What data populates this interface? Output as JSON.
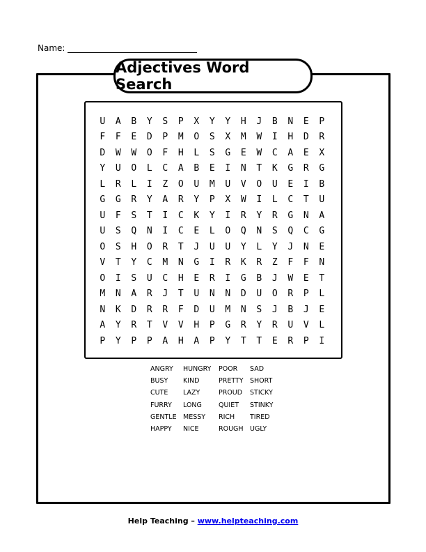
{
  "header": {
    "name_label": "Name:"
  },
  "title": "Adjectives Word Search",
  "grid": [
    [
      "U",
      "A",
      "B",
      "Y",
      "S",
      "P",
      "X",
      "Y",
      "Y",
      "H",
      "J",
      "B",
      "N",
      "E",
      "P"
    ],
    [
      "F",
      "F",
      "E",
      "D",
      "P",
      "M",
      "O",
      "S",
      "X",
      "M",
      "W",
      "I",
      "H",
      "D",
      "R"
    ],
    [
      "D",
      "W",
      "W",
      "O",
      "F",
      "H",
      "L",
      "S",
      "G",
      "E",
      "W",
      "C",
      "A",
      "E",
      "X"
    ],
    [
      "Y",
      "U",
      "O",
      "L",
      "C",
      "A",
      "B",
      "E",
      "I",
      "N",
      "T",
      "K",
      "G",
      "R",
      "G"
    ],
    [
      "L",
      "R",
      "L",
      "I",
      "Z",
      "O",
      "U",
      "M",
      "U",
      "V",
      "O",
      "U",
      "E",
      "I",
      "B"
    ],
    [
      "G",
      "G",
      "R",
      "Y",
      "A",
      "R",
      "Y",
      "P",
      "X",
      "W",
      "I",
      "L",
      "C",
      "T",
      "U"
    ],
    [
      "U",
      "F",
      "S",
      "T",
      "I",
      "C",
      "K",
      "Y",
      "I",
      "R",
      "Y",
      "R",
      "G",
      "N",
      "A"
    ],
    [
      "U",
      "S",
      "Q",
      "N",
      "I",
      "C",
      "E",
      "L",
      "O",
      "Q",
      "N",
      "S",
      "Q",
      "C",
      "G"
    ],
    [
      "O",
      "S",
      "H",
      "O",
      "R",
      "T",
      "J",
      "U",
      "U",
      "Y",
      "L",
      "Y",
      "J",
      "N",
      "E"
    ],
    [
      "V",
      "T",
      "Y",
      "C",
      "M",
      "N",
      "G",
      "I",
      "R",
      "K",
      "R",
      "Z",
      "F",
      "F",
      "N"
    ],
    [
      "O",
      "I",
      "S",
      "U",
      "C",
      "H",
      "E",
      "R",
      "I",
      "G",
      "B",
      "J",
      "W",
      "E",
      "T"
    ],
    [
      "M",
      "N",
      "A",
      "R",
      "J",
      "T",
      "U",
      "N",
      "N",
      "D",
      "U",
      "O",
      "R",
      "P",
      "L"
    ],
    [
      "N",
      "K",
      "D",
      "R",
      "R",
      "F",
      "D",
      "U",
      "M",
      "N",
      "S",
      "J",
      "B",
      "J",
      "E"
    ],
    [
      "A",
      "Y",
      "R",
      "T",
      "V",
      "V",
      "H",
      "P",
      "G",
      "R",
      "Y",
      "R",
      "U",
      "V",
      "L"
    ],
    [
      "P",
      "Y",
      "P",
      "P",
      "A",
      "H",
      "A",
      "P",
      "Y",
      "T",
      "T",
      "E",
      "R",
      "P",
      "I"
    ]
  ],
  "word_list": [
    "ANGRY",
    "HUNGRY",
    "POOR",
    "SAD",
    "BUSY",
    "KIND",
    "PRETTY",
    "SHORT",
    "CUTE",
    "LAZY",
    "PROUD",
    "STICKY",
    "FURRY",
    "LONG",
    "QUIET",
    "STINKY",
    "GENTLE",
    "MESSY",
    "RICH",
    "TIRED",
    "HAPPY",
    "NICE",
    "ROUGH",
    "UGLY"
  ],
  "footer": {
    "brand": "Help Teaching – ",
    "link_text": "www.helpteaching.com"
  }
}
